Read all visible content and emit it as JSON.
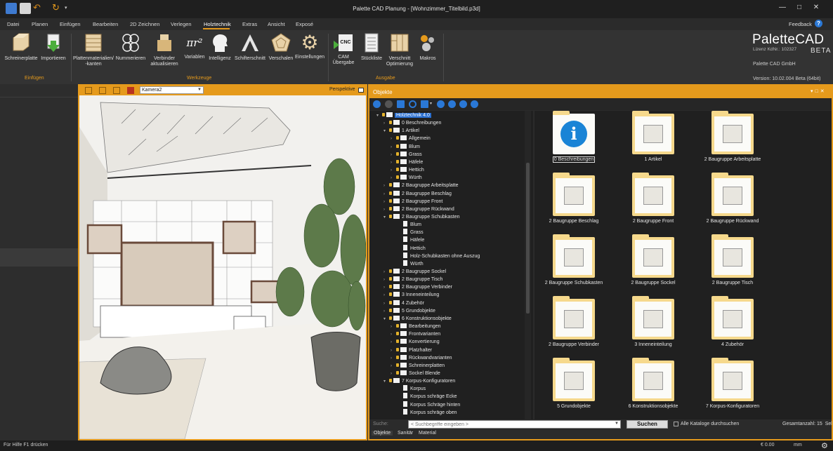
{
  "window": {
    "title": "Palette CAD Planung - [Wohnzimmer_Titelbild.p3d]",
    "controls": [
      "—",
      "□",
      "✕"
    ]
  },
  "menu": {
    "tabs": [
      "Datei",
      "Planen",
      "Einfügen",
      "Bearbeiten",
      "2D Zeichnen",
      "Verlegen",
      "Holztechnik",
      "Extras",
      "Ansicht",
      "Exposé"
    ],
    "active": "Holztechnik",
    "feedback": "Feedback",
    "help": "?"
  },
  "ribbon": {
    "buttons": [
      {
        "label": "Schreinerplatte",
        "icon": "panel-board-icon"
      },
      {
        "label": "Importieren",
        "icon": "import-icon"
      },
      {
        "label": "Plattenmaterialien/\n-kanten",
        "icon": "board-materials-icon"
      },
      {
        "label": "Nummerieren",
        "icon": "numbering-icon"
      },
      {
        "label": "Verbinder\naktualisieren",
        "icon": "connector-update-icon"
      },
      {
        "label": "Variablen",
        "icon": "variables-icon"
      },
      {
        "label": "Intelligenz",
        "icon": "intelligence-icon"
      },
      {
        "label": "Schifterschnitt",
        "icon": "miter-cut-icon"
      },
      {
        "label": "Verschalen",
        "icon": "cladding-icon"
      },
      {
        "label": "Einstellungen",
        "icon": "gear-icon"
      },
      {
        "label": "CAM\nÜbergabe",
        "icon": "cam-transfer-icon"
      },
      {
        "label": "Stückliste",
        "icon": "parts-list-icon"
      },
      {
        "label": "Verschnitt\nOptimierung",
        "icon": "cut-optimization-icon"
      },
      {
        "label": "Makros",
        "icon": "macros-icon"
      }
    ],
    "variablen_symbol": "πr²",
    "cnc_text": "CNC",
    "groups": [
      "Einfügen",
      "Werkzeuge",
      "Ausgabe"
    ],
    "brand": {
      "name_a": "Palette",
      "name_b": "CAD",
      "beta": "BETA",
      "lizenz": "Lizenz KdNr.: 102327",
      "company": "Palette CAD GmbH",
      "version": "Version: 10.02.004 Beta (64bit)"
    }
  },
  "viewport": {
    "camera": "Kamera2",
    "mode": "Perspektive"
  },
  "objekte": {
    "title": "Objekte",
    "tree": [
      {
        "label": "Holztechnik 4.0",
        "indent": 0,
        "arrow": "▾",
        "type": "folder",
        "selected": true
      },
      {
        "label": "0 Beschreibungen",
        "indent": 1,
        "arrow": "›",
        "type": "folder"
      },
      {
        "label": "1 Artikel",
        "indent": 1,
        "arrow": "▾",
        "type": "folder"
      },
      {
        "label": "Allgemein",
        "indent": 2,
        "arrow": "›",
        "type": "folder"
      },
      {
        "label": "Blum",
        "indent": 2,
        "arrow": "›",
        "type": "folder"
      },
      {
        "label": "Grass",
        "indent": 2,
        "arrow": "›",
        "type": "folder"
      },
      {
        "label": "Häfele",
        "indent": 2,
        "arrow": "›",
        "type": "folder"
      },
      {
        "label": "Hettich",
        "indent": 2,
        "arrow": "›",
        "type": "folder"
      },
      {
        "label": "Würth",
        "indent": 2,
        "arrow": "›",
        "type": "folder"
      },
      {
        "label": "2 Baugruppe Arbeitsplatte",
        "indent": 1,
        "arrow": "›",
        "type": "folder"
      },
      {
        "label": "2 Baugruppe Beschlag",
        "indent": 1,
        "arrow": "›",
        "type": "folder"
      },
      {
        "label": "2 Baugruppe Front",
        "indent": 1,
        "arrow": "›",
        "type": "folder"
      },
      {
        "label": "2 Baugruppe Rückwand",
        "indent": 1,
        "arrow": "›",
        "type": "folder"
      },
      {
        "label": "2 Baugruppe Schubkasten",
        "indent": 1,
        "arrow": "▾",
        "type": "folder"
      },
      {
        "label": "Blum",
        "indent": 3,
        "arrow": "",
        "type": "doc"
      },
      {
        "label": "Grass",
        "indent": 3,
        "arrow": "",
        "type": "doc"
      },
      {
        "label": "Häfele",
        "indent": 3,
        "arrow": "",
        "type": "doc"
      },
      {
        "label": "Hettich",
        "indent": 3,
        "arrow": "",
        "type": "doc"
      },
      {
        "label": "Holz-Schubkasten ohne Auszug",
        "indent": 3,
        "arrow": "",
        "type": "doc"
      },
      {
        "label": "Würth",
        "indent": 3,
        "arrow": "",
        "type": "doc"
      },
      {
        "label": "2 Baugruppe Sockel",
        "indent": 1,
        "arrow": "›",
        "type": "folder"
      },
      {
        "label": "2 Baugruppe Tisch",
        "indent": 1,
        "arrow": "›",
        "type": "folder"
      },
      {
        "label": "2 Baugruppe Verbinder",
        "indent": 1,
        "arrow": "›",
        "type": "folder"
      },
      {
        "label": "3 Inneneinteilung",
        "indent": 1,
        "arrow": "›",
        "type": "folder"
      },
      {
        "label": "4 Zubehör",
        "indent": 1,
        "arrow": "›",
        "type": "folder"
      },
      {
        "label": "5 Grundobjekte",
        "indent": 1,
        "arrow": "›",
        "type": "folder"
      },
      {
        "label": "6 Konstruktionsobjekte",
        "indent": 1,
        "arrow": "▾",
        "type": "folder"
      },
      {
        "label": "Bearbeitungen",
        "indent": 2,
        "arrow": "›",
        "type": "folder"
      },
      {
        "label": "Frontvarianten",
        "indent": 2,
        "arrow": "›",
        "type": "folder"
      },
      {
        "label": "Konvertierung",
        "indent": 2,
        "arrow": "›",
        "type": "folder"
      },
      {
        "label": "Platzhalter",
        "indent": 2,
        "arrow": "›",
        "type": "folder"
      },
      {
        "label": "Rückwandvarianten",
        "indent": 2,
        "arrow": "›",
        "type": "folder"
      },
      {
        "label": "Schreinerplatten",
        "indent": 2,
        "arrow": "›",
        "type": "folder"
      },
      {
        "label": "Sockel Blende",
        "indent": 2,
        "arrow": "›",
        "type": "folder"
      },
      {
        "label": "7 Korpus-Konfiguratoren",
        "indent": 1,
        "arrow": "▾",
        "type": "folder"
      },
      {
        "label": "Korpus",
        "indent": 3,
        "arrow": "",
        "type": "doc"
      },
      {
        "label": "Korpus schräge Ecke",
        "indent": 3,
        "arrow": "",
        "type": "doc"
      },
      {
        "label": "Korpus Schräge hinten",
        "indent": 3,
        "arrow": "",
        "type": "doc"
      },
      {
        "label": "Korpus schräge oben",
        "indent": 3,
        "arrow": "",
        "type": "doc"
      }
    ],
    "grid": [
      {
        "caption": "0 Beschreibungen",
        "icon": "info-icon",
        "selected": true
      },
      {
        "caption": "1 Artikel",
        "icon": "hardware-items-icon"
      },
      {
        "caption": "2 Baugruppe Arbeitsplatte",
        "icon": "worktop-icon"
      },
      {
        "caption": "2 Baugruppe Beschlag",
        "icon": "fitting-icon"
      },
      {
        "caption": "2 Baugruppe Front",
        "icon": "front-panel-icon"
      },
      {
        "caption": "2 Baugruppe Rückwand",
        "icon": "back-panel-icon"
      },
      {
        "caption": "2 Baugruppe Schubkasten",
        "icon": "drawer-icon"
      },
      {
        "caption": "2 Baugruppe Sockel",
        "icon": "plinth-icon"
      },
      {
        "caption": "2 Baugruppe Tisch",
        "icon": "table-top-icon"
      },
      {
        "caption": "2 Baugruppe Verbinder",
        "icon": "connector-icon"
      },
      {
        "caption": "3 Inneneinteilung",
        "icon": "interior-division-icon"
      },
      {
        "caption": "4 Zubehör",
        "icon": "accessories-icon"
      },
      {
        "caption": "5 Grundobjekte",
        "icon": "basic-objects-icon"
      },
      {
        "caption": "6 Konstruktionsobjekte",
        "icon": "construction-objects-icon"
      },
      {
        "caption": "7 Korpus-Konfiguratoren",
        "icon": "cabinet-configurator-icon"
      }
    ],
    "search": {
      "label": "Suche:",
      "placeholder": "< Suchbegriffe eingeben >",
      "button": "Suchen",
      "all_catalogs": "Alle Kataloge durchsuchen",
      "total": "Gesamtanzahl: 15",
      "total_extra": "Sel"
    },
    "bottom_tabs": [
      "Objekte",
      "Sanitär",
      "Material"
    ]
  },
  "status": {
    "help": "Für Hilfe F1 drücken",
    "money": "€ 0.00",
    "unit": "mm"
  },
  "colors": {
    "accent": "#e59a1c",
    "selection": "#2a6fd0",
    "folder": "#f6d98c"
  }
}
